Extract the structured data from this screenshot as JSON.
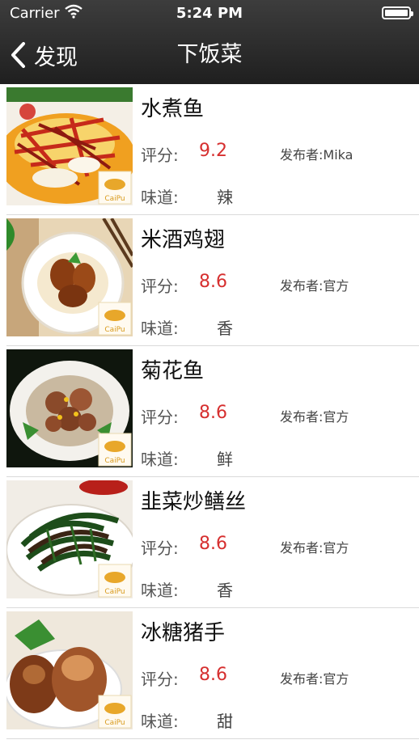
{
  "status": {
    "carrier": "Carrier",
    "time": "5:24 PM"
  },
  "nav": {
    "back_label": "发现",
    "title": "下饭菜"
  },
  "labels": {
    "score": "评分:",
    "taste": "味道:",
    "logo": "CaiPu"
  },
  "items": [
    {
      "name": "水煮鱼",
      "score": "9.2",
      "author": "发布者:Mika",
      "taste": "辣"
    },
    {
      "name": "米酒鸡翅",
      "score": "8.6",
      "author": "发布者:官方",
      "taste": "香"
    },
    {
      "name": "菊花鱼",
      "score": "8.6",
      "author": "发布者:官方",
      "taste": "鲜"
    },
    {
      "name": "韭菜炒鳝丝",
      "score": "8.6",
      "author": "发布者:官方",
      "taste": "香"
    },
    {
      "name": "冰糖猪手",
      "score": "8.6",
      "author": "发布者:官方",
      "taste": "甜"
    }
  ],
  "colors": {
    "score": "#d62f2f",
    "navbar": "#2b2b2b"
  }
}
